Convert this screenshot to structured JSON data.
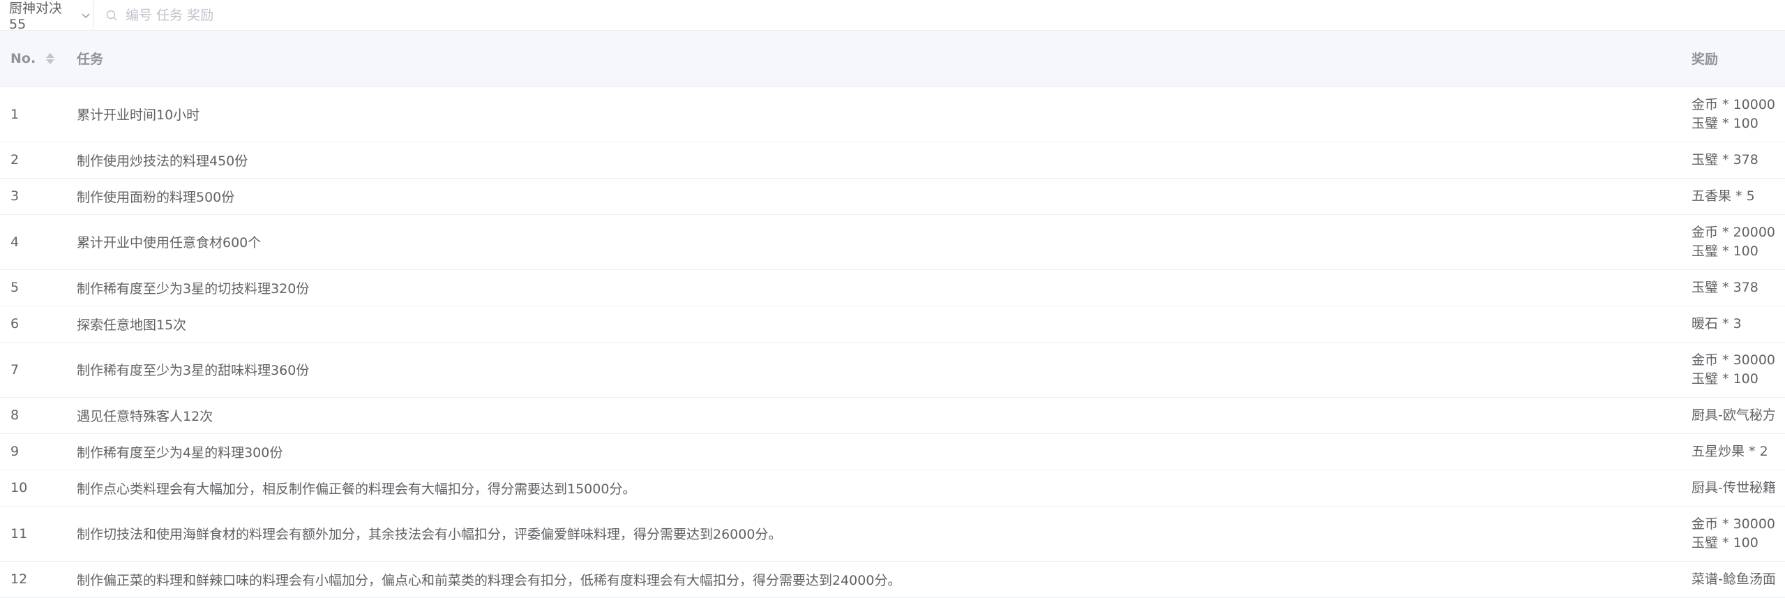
{
  "toolbar": {
    "select_value": "厨神对决55",
    "search_placeholder": "编号 任务 奖励"
  },
  "table": {
    "headers": {
      "no": "No.",
      "task": "任务",
      "reward": "奖励"
    },
    "rows": [
      {
        "no": "1",
        "task": "累计开业时间10小时",
        "rewards": [
          "金币 * 10000",
          "玉璧 * 100"
        ]
      },
      {
        "no": "2",
        "task": "制作使用炒技法的料理450份",
        "rewards": [
          "玉璧 * 378"
        ]
      },
      {
        "no": "3",
        "task": "制作使用面粉的料理500份",
        "rewards": [
          "五香果 * 5"
        ]
      },
      {
        "no": "4",
        "task": "累计开业中使用任意食材600个",
        "rewards": [
          "金币 * 20000",
          "玉璧 * 100"
        ]
      },
      {
        "no": "5",
        "task": "制作稀有度至少为3星的切技料理320份",
        "rewards": [
          "玉璧 * 378"
        ]
      },
      {
        "no": "6",
        "task": "探索任意地图15次",
        "rewards": [
          "暖石 * 3"
        ]
      },
      {
        "no": "7",
        "task": "制作稀有度至少为3星的甜味料理360份",
        "rewards": [
          "金币 * 30000",
          "玉璧 * 100"
        ]
      },
      {
        "no": "8",
        "task": "遇见任意特殊客人12次",
        "rewards": [
          "厨具-欧气秘方"
        ]
      },
      {
        "no": "9",
        "task": "制作稀有度至少为4星的料理300份",
        "rewards": [
          "五星炒果 * 2"
        ]
      },
      {
        "no": "10",
        "task": "制作点心类料理会有大幅加分，相反制作偏正餐的料理会有大幅扣分，得分需要达到15000分。",
        "rewards": [
          "厨具-传世秘籍"
        ]
      },
      {
        "no": "11",
        "task": "制作切技法和使用海鲜食材的料理会有额外加分，其余技法会有小幅扣分，评委偏爱鲜味料理，得分需要达到26000分。",
        "rewards": [
          "金币 * 30000",
          "玉璧 * 100"
        ]
      },
      {
        "no": "12",
        "task": "制作偏正菜的料理和鲜辣口味的料理会有小幅加分，偏点心和前菜类的料理会有扣分，低稀有度料理会有大幅扣分，得分需要达到24000分。",
        "rewards": [
          "菜谱-鲶鱼汤面"
        ]
      }
    ]
  }
}
